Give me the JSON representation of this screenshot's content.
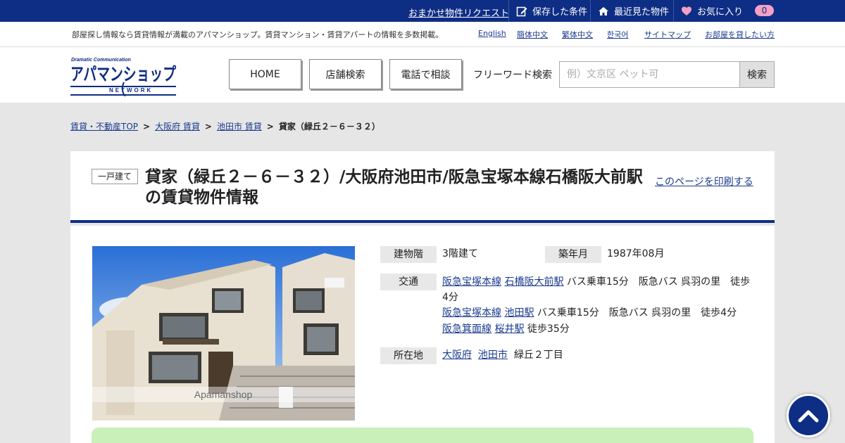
{
  "topbar": {
    "request_link": "おまかせ物件リクエスト",
    "saved_conditions": "保存した条件",
    "recently_viewed": "最近見た物件",
    "favorites": "お気に入り",
    "favorites_count": "0"
  },
  "subbar": {
    "tagline": "部屋探し情報なら賃貸情報が満載のアパマンショップ。賃貸マンション・賃貸アパートの情報を多数掲載。",
    "links": [
      "English",
      "簡体中文",
      "繁体中文",
      "한국어",
      "サイトマップ",
      "お部屋を貸したい方"
    ]
  },
  "header": {
    "logo_small": "Dramatic Communication",
    "logo_main": "アパマンショップ",
    "logo_sub": "NETWORK",
    "nav": [
      "HOME",
      "店舗検索",
      "電話で相談"
    ],
    "freeword_label": "フリーワード検索",
    "search_placeholder": "例）文京区 ペット可",
    "search_button": "検索"
  },
  "breadcrumb": {
    "items": [
      "賃貸・不動産TOP",
      "大阪府 賃貸",
      "池田市 賃貸"
    ],
    "current": "貸家（緑丘２－６－３２）"
  },
  "property": {
    "type_tag": "一戸建て",
    "title": "貸家（緑丘２－６－３２）/大阪府池田市/阪急宝塚本線石橋阪大前駅の賃貸物件情報",
    "print_link": "このページを印刷する",
    "photo_watermark": "Apamanshop",
    "floors_label": "建物階",
    "floors_value": "3階建て",
    "built_label": "築年月",
    "built_value": "1987年08月",
    "transit_label": "交通",
    "transit": [
      {
        "line": "阪急宝塚本線",
        "station": "石橋阪大前駅",
        "detail": "バス乗車15分　阪急バス 呉羽の里　徒歩4分"
      },
      {
        "line": "阪急宝塚本線",
        "station": "池田駅",
        "detail": "バス乗車15分　阪急バス 呉羽の里　徒歩4分"
      },
      {
        "line": "阪急箕面線",
        "station": "桜井駅",
        "detail": "徒歩35分"
      }
    ],
    "address_label": "所在地",
    "address_pref": "大阪府",
    "address_city": "池田市",
    "address_rest": "緑丘２丁目"
  },
  "colors": {
    "brand_navy": "#0e2d84",
    "favorites_pink": "#f2a0c4",
    "cta_green": "#c8f0b8"
  },
  "icons": [
    "edit-icon",
    "home-icon",
    "heart-icon",
    "chevron-up-icon"
  ]
}
